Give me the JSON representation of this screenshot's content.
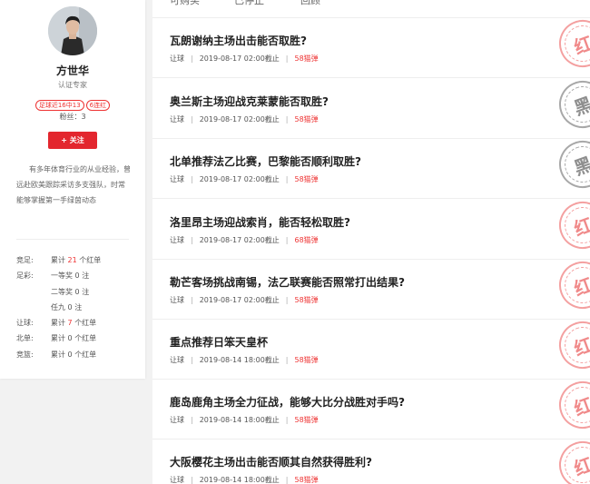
{
  "profile": {
    "name": "方世华",
    "role": "认证专家",
    "badges": [
      "足球近16中13",
      "6连红"
    ],
    "fans": "粉丝：3",
    "follow_label": "+ 关注",
    "bio": "有多年体育行业的从业经验，曾远赴欧美跟踪采访多支强队，时常能够掌握第一手绿茵动态",
    "stats": [
      {
        "label": "竞足:",
        "pre": "累计",
        "num": "21",
        "post": "个红单"
      },
      {
        "label": "足彩:",
        "pre": "一等奖",
        "num": "0",
        "post": "注"
      },
      {
        "label": "",
        "pre": "二等奖",
        "num": "0",
        "post": "注"
      },
      {
        "label": "",
        "pre": "任九",
        "num": "0",
        "post": "注"
      },
      {
        "label": "让球:",
        "pre": "累计",
        "num": "7",
        "post": "个红单"
      },
      {
        "label": "北单:",
        "pre": "累计",
        "num": "0",
        "post": "个红单"
      },
      {
        "label": "竞篮:",
        "pre": "累计",
        "num": "0",
        "post": "个红单"
      }
    ]
  },
  "tabs": [
    "可购买",
    "已停止",
    "回顾"
  ],
  "items": [
    {
      "title": "瓦朗谢纳主场出击能否取胜?",
      "type": "让球",
      "date": "2019-08-17 02:00截止",
      "price": "58猫弹",
      "stamp": "红",
      "stamp_color": "red"
    },
    {
      "title": "奥兰斯主场迎战克莱蒙能否取胜?",
      "type": "让球",
      "date": "2019-08-17 02:00截止",
      "price": "58猫弹",
      "stamp": "黑",
      "stamp_color": "black"
    },
    {
      "title": "北单推荐法乙比赛，巴黎能否顺利取胜?",
      "type": "让球",
      "date": "2019-08-17 02:00截止",
      "price": "58猫弹",
      "stamp": "黑",
      "stamp_color": "black"
    },
    {
      "title": "洛里昂主场迎战索肖，能否轻松取胜?",
      "type": "让球",
      "date": "2019-08-17 02:00截止",
      "price": "68猫弹",
      "stamp": "红",
      "stamp_color": "red"
    },
    {
      "title": "勒芒客场挑战南锡，法乙联赛能否照常打出结果?",
      "type": "让球",
      "date": "2019-08-17 02:00截止",
      "price": "58猫弹",
      "stamp": "红",
      "stamp_color": "red"
    },
    {
      "title": "重点推荐日笨天皇杯",
      "type": "让球",
      "date": "2019-08-14 18:00截止",
      "price": "58猫弹",
      "stamp": "红",
      "stamp_color": "red"
    },
    {
      "title": "鹿岛鹿角主场全力征战，能够大比分战胜对手吗?",
      "type": "让球",
      "date": "2019-08-14 18:00截止",
      "price": "58猫弹",
      "stamp": "红",
      "stamp_color": "red"
    },
    {
      "title": "大阪樱花主场出击能否顺其自然获得胜利?",
      "type": "让球",
      "date": "2019-08-14 18:00截止",
      "price": "58猫弹",
      "stamp": "红",
      "stamp_color": "red"
    }
  ]
}
